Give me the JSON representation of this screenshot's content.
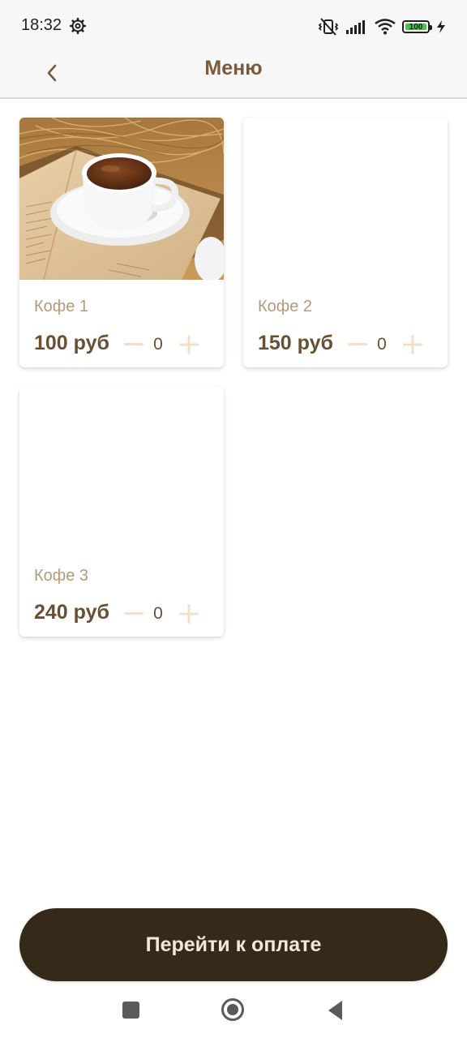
{
  "status_bar": {
    "time": "18:32",
    "battery": "100",
    "icons": [
      "settings-icon",
      "vibrate-icon",
      "signal-icon",
      "wifi-icon",
      "battery-icon",
      "charging-icon"
    ]
  },
  "app_bar": {
    "title": "Меню",
    "back_icon": "chevron-left-icon"
  },
  "products": [
    {
      "name": "Кофе 1",
      "price": "100 руб",
      "quantity": "0",
      "has_image": true
    },
    {
      "name": "Кофе 2",
      "price": "150 руб",
      "quantity": "0",
      "has_image": false
    },
    {
      "name": "Кофе 3",
      "price": "240 руб",
      "quantity": "0",
      "has_image": false
    }
  ],
  "checkout": {
    "label": "Перейти к оплате"
  },
  "colors": {
    "title": "#7a5a3a",
    "price": "#6a5032",
    "product_name": "#b39a7b",
    "stepper": "#f3dfc7",
    "checkout_background": "#35291a",
    "checkout_text": "#f1e8dc"
  }
}
